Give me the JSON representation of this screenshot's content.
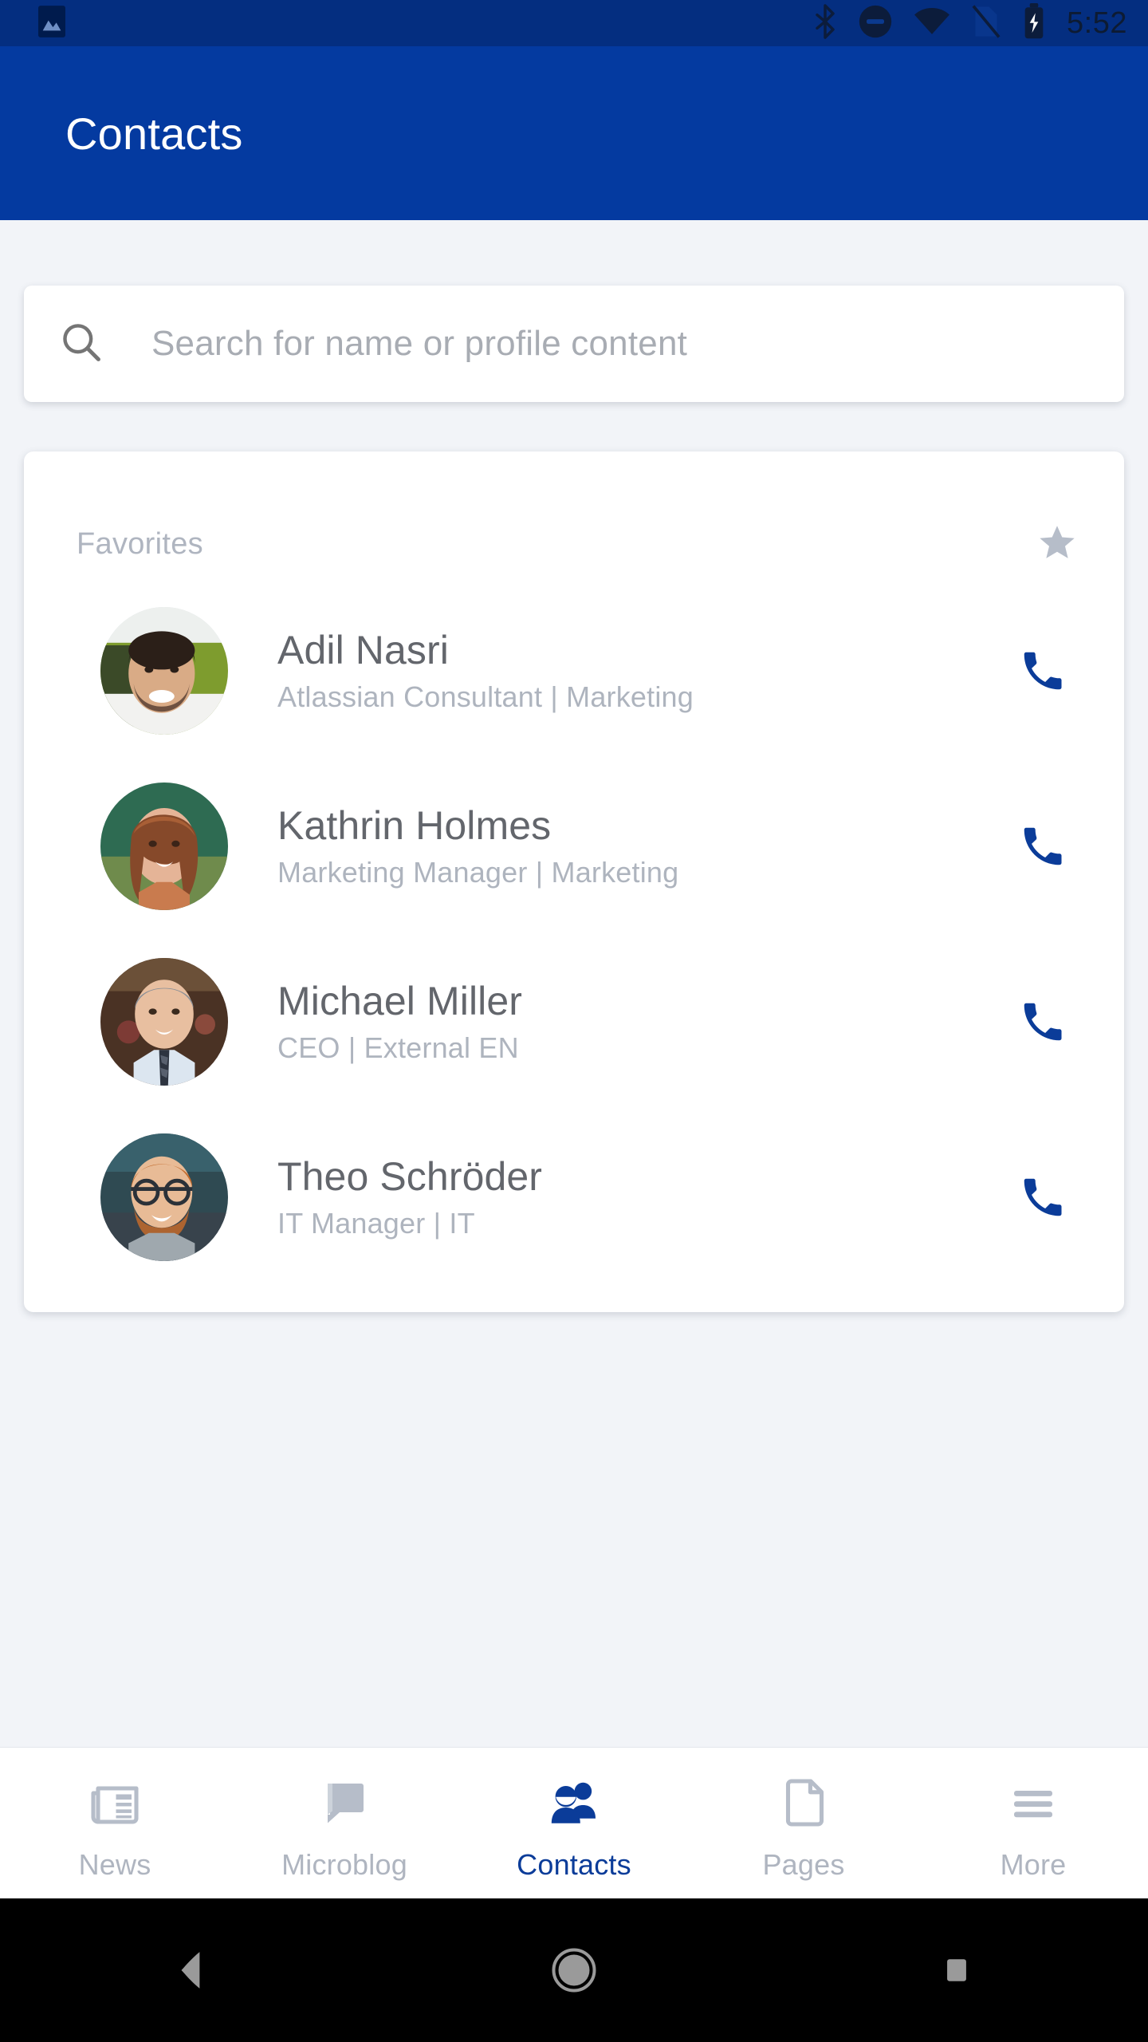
{
  "status_bar": {
    "time": "5:52",
    "left_icons": [
      "photo-icon"
    ],
    "right_icons": [
      "bluetooth-icon",
      "do-not-disturb-icon",
      "wifi-icon",
      "sim-off-icon",
      "battery-charging-icon"
    ]
  },
  "app_bar": {
    "title": "Contacts"
  },
  "search": {
    "placeholder": "Search for name or profile content",
    "value": "",
    "icon": "search-icon"
  },
  "favorites_section": {
    "title": "Favorites",
    "icon": "star-icon"
  },
  "contacts": [
    {
      "name": "Adil Nasri",
      "subtitle": "Atlassian Consultant | Marketing",
      "action_icon": "phone-icon"
    },
    {
      "name": "Kathrin Holmes",
      "subtitle": "Marketing Manager | Marketing",
      "action_icon": "phone-icon"
    },
    {
      "name": "Michael Miller",
      "subtitle": "CEO | External EN",
      "action_icon": "phone-icon"
    },
    {
      "name": "Theo Schröder",
      "subtitle": "IT Manager | IT",
      "action_icon": "phone-icon"
    }
  ],
  "bottom_nav": {
    "active": "Contacts",
    "items": [
      {
        "label": "News",
        "icon": "newspaper-icon"
      },
      {
        "label": "Microblog",
        "icon": "chat-bubble-icon"
      },
      {
        "label": "Contacts",
        "icon": "people-icon"
      },
      {
        "label": "Pages",
        "icon": "document-icon"
      },
      {
        "label": "More",
        "icon": "hamburger-menu-icon"
      }
    ]
  },
  "android_nav": {
    "buttons": [
      "back-button",
      "home-button",
      "recents-button"
    ]
  },
  "colors": {
    "app_bar_blue": "#043AA0",
    "status_bar_blue": "#042E80",
    "accent_blue": "#0B3C99",
    "page_background": "#F2F4F8",
    "card_white": "#FFFFFF",
    "muted_gray": "#AFB5C0",
    "name_gray": "#63666C"
  }
}
